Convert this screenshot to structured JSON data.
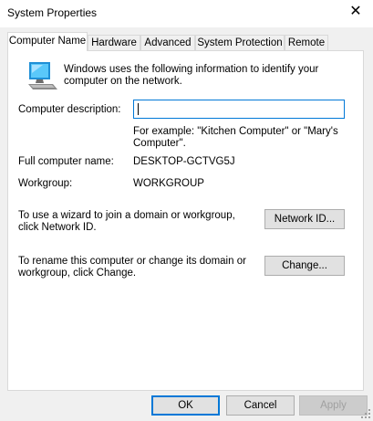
{
  "window": {
    "title": "System Properties",
    "close_glyph": "✕"
  },
  "tabs": [
    {
      "label": "Computer Name",
      "active": true
    },
    {
      "label": "Hardware"
    },
    {
      "label": "Advanced"
    },
    {
      "label": "System Protection"
    },
    {
      "label": "Remote"
    }
  ],
  "panel": {
    "intro": "Windows uses the following information to identify your computer on the network.",
    "description_label": "Computer description:",
    "description_value": "",
    "example_text": "For example: \"Kitchen Computer\" or \"Mary's Computer\".",
    "full_name_label": "Full computer name:",
    "full_name_value": "DESKTOP-GCTVG5J",
    "workgroup_label": "Workgroup:",
    "workgroup_value": "WORKGROUP",
    "network_id_text": "To use a wizard to join a domain or workgroup, click Network ID.",
    "network_id_button": "Network ID...",
    "change_text": "To rename this computer or change its domain or workgroup, click Change.",
    "change_button": "Change..."
  },
  "footer": {
    "ok": "OK",
    "cancel": "Cancel",
    "apply": "Apply"
  },
  "icons": {
    "computer": "computer-icon",
    "close": "close-icon",
    "resize": "resize-grip-icon"
  },
  "colors": {
    "accent": "#0078d7",
    "panel_bg": "#ffffff",
    "window_bg": "#f0f0f0"
  }
}
